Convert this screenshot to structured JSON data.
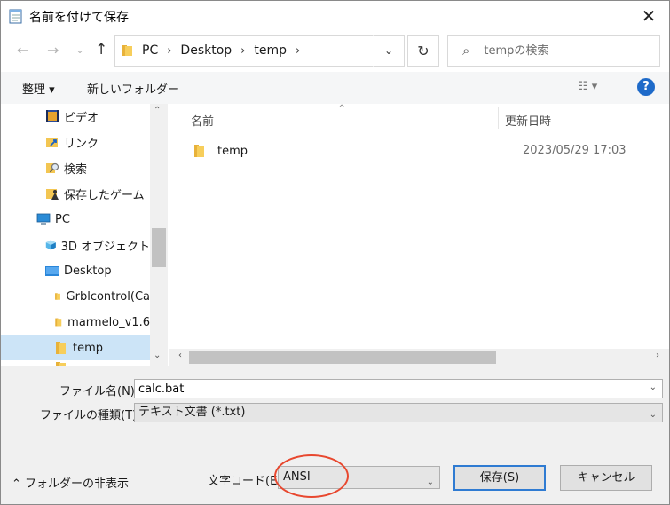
{
  "window": {
    "title": "名前を付けて保存",
    "close_icon": "✕"
  },
  "nav": {
    "back_icon": "←",
    "forward_icon": "→",
    "recent_icon": "⌄",
    "up_icon": "↑",
    "breadcrumbs": [
      "PC",
      "Desktop",
      "temp"
    ],
    "separator": "›",
    "dropdown_icon": "⌄",
    "refresh_icon": "↻",
    "search_placeholder": "tempの検索",
    "search_icon": "⌕"
  },
  "toolbar": {
    "organize_label": "整理 ▾",
    "new_folder_label": "新しいフォルダー",
    "view_label": "☷ ▾",
    "help_label": "?"
  },
  "navpane": {
    "items": [
      {
        "label": "ビデオ",
        "icon": "video-icon"
      },
      {
        "label": "リンク",
        "icon": "link-folder-icon"
      },
      {
        "label": "検索",
        "icon": "search-folder-icon"
      },
      {
        "label": "保存したゲーム",
        "icon": "saved-games-icon"
      },
      {
        "label": "PC",
        "icon": "pc-icon"
      },
      {
        "label": "3D オブジェクト",
        "icon": "3d-objects-icon"
      },
      {
        "label": "Desktop",
        "icon": "desktop-icon"
      },
      {
        "label": "Grblcontrol(Ca",
        "icon": "folder-icon"
      },
      {
        "label": "marmelo_v1.6",
        "icon": "folder-icon"
      },
      {
        "label": "temp",
        "icon": "folder-icon"
      }
    ],
    "scroll_up": "⌃",
    "scroll_down": "⌄"
  },
  "filelist": {
    "columns": {
      "name": "名前",
      "date": "更新日時"
    },
    "sort_caret": "^",
    "rows": [
      {
        "name": "temp",
        "date": "2023/05/29 17:03"
      }
    ],
    "scroll_left": "‹",
    "scroll_right": "›"
  },
  "form": {
    "filename_label": "ファイル名(N):",
    "filename_value": "calc.bat",
    "filetype_label": "ファイルの種類(T):",
    "filetype_value": "テキスト文書 (*.txt)",
    "dropdown_arrow": "⌄"
  },
  "footer": {
    "hide_folders_label": "⌃ フォルダーの非表示",
    "charcode_label": "文字コード(E):",
    "charcode_value": "ANSI",
    "save_label": "保存(S)",
    "cancel_label": "キャンセル",
    "highlight_color": "#e8482f"
  }
}
